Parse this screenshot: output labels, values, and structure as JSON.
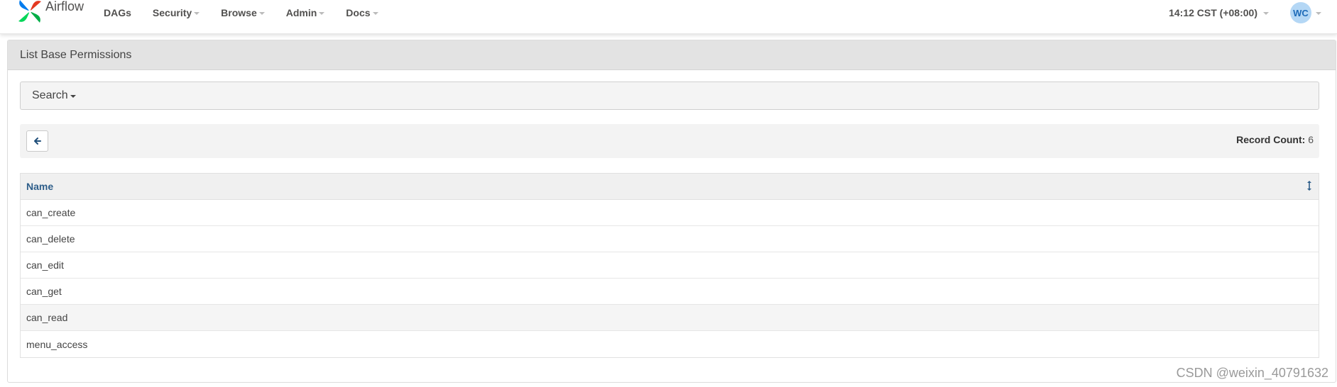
{
  "nav": {
    "brand": "Airflow",
    "items": [
      {
        "label": "DAGs",
        "dropdown": false
      },
      {
        "label": "Security",
        "dropdown": true
      },
      {
        "label": "Browse",
        "dropdown": true
      },
      {
        "label": "Admin",
        "dropdown": true
      },
      {
        "label": "Docs",
        "dropdown": true
      }
    ],
    "clock": "14:12 CST (+08:00)",
    "user_initials": "WC"
  },
  "panel": {
    "title": "List Base Permissions",
    "search_label": "Search",
    "record_count_label": "Record Count:",
    "record_count": "6"
  },
  "table": {
    "columns": [
      "Name"
    ],
    "rows": [
      "can_create",
      "can_delete",
      "can_edit",
      "can_get",
      "can_read",
      "menu_access"
    ]
  },
  "watermark": "CSDN @weixin_40791632",
  "colors": {
    "header_link": "#2e5e8a",
    "avatar_bg": "#b4d7f5",
    "panel_heading": "#e3e3e3"
  },
  "icons": [
    "airflow-logo-icon",
    "arrow-left-icon",
    "sort-icon",
    "chevron-down-icon"
  ]
}
